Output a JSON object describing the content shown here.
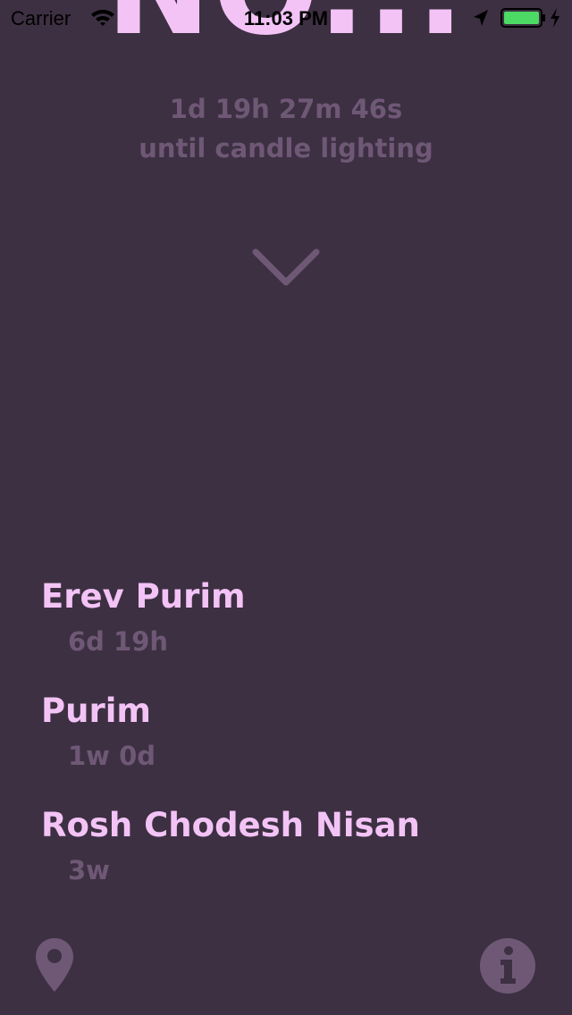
{
  "status_bar": {
    "carrier": "Carrier",
    "time": "11:03 PM",
    "icons": [
      "wifi-icon",
      "location-arrow-icon",
      "battery-icon",
      "charging-icon"
    ],
    "battery_color": "#4cd964"
  },
  "header": {
    "title": "NO..."
  },
  "countdown": {
    "value": "1d 19h 27m 46s",
    "label": "until candle lighting"
  },
  "holidays": [
    {
      "name": "Erev Purim",
      "time": "6d 19h"
    },
    {
      "name": "Purim",
      "time": "1w 0d"
    },
    {
      "name": "Rosh Chodesh Nisan",
      "time": "3w"
    }
  ],
  "footer": {
    "left_icon": "map-pin-icon",
    "right_icon": "info-icon"
  },
  "colors": {
    "background": "#3d3042",
    "primary_text": "#f3c3f6",
    "secondary_text": "#6f5876"
  }
}
